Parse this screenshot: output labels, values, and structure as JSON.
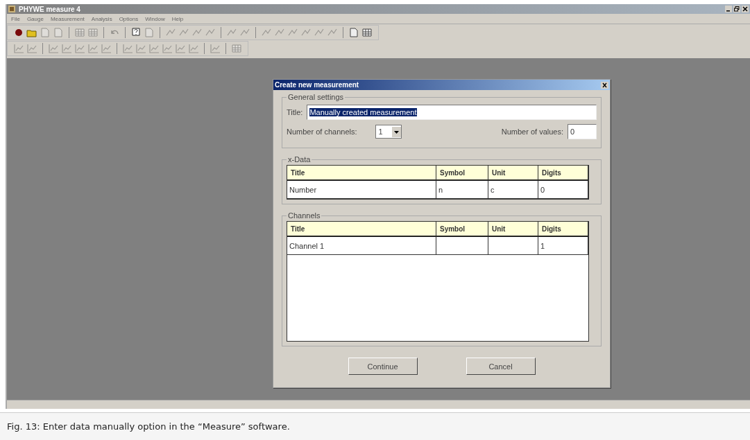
{
  "window": {
    "title": "PHYWE measure 4"
  },
  "menu": [
    "File",
    "Gauge",
    "Measurement",
    "Analysis",
    "Options",
    "Window",
    "Help"
  ],
  "dialog": {
    "title": "Create new measurement",
    "general": {
      "legend": "General settings",
      "title_label": "Title:",
      "title_value": "Manually created measurement",
      "title_selected": true,
      "channels_label": "Number of channels:",
      "channels_value": "1",
      "values_label": "Number of values:",
      "values_value": "0"
    },
    "x_data": {
      "legend": "x-Data",
      "columns": [
        "Title",
        "Symbol",
        "Unit",
        "Digits"
      ],
      "rows": [
        [
          "Number",
          "n",
          "c",
          "0"
        ]
      ]
    },
    "channels": {
      "legend": "Channels",
      "columns": [
        "Title",
        "Symbol",
        "Unit",
        "Digits"
      ],
      "rows": [
        [
          "Channel 1",
          "",
          "",
          "1"
        ]
      ]
    },
    "buttons": [
      "Continue",
      "Cancel"
    ]
  },
  "caption": "Fig. 13: Enter data manually option in the “Measure” software."
}
